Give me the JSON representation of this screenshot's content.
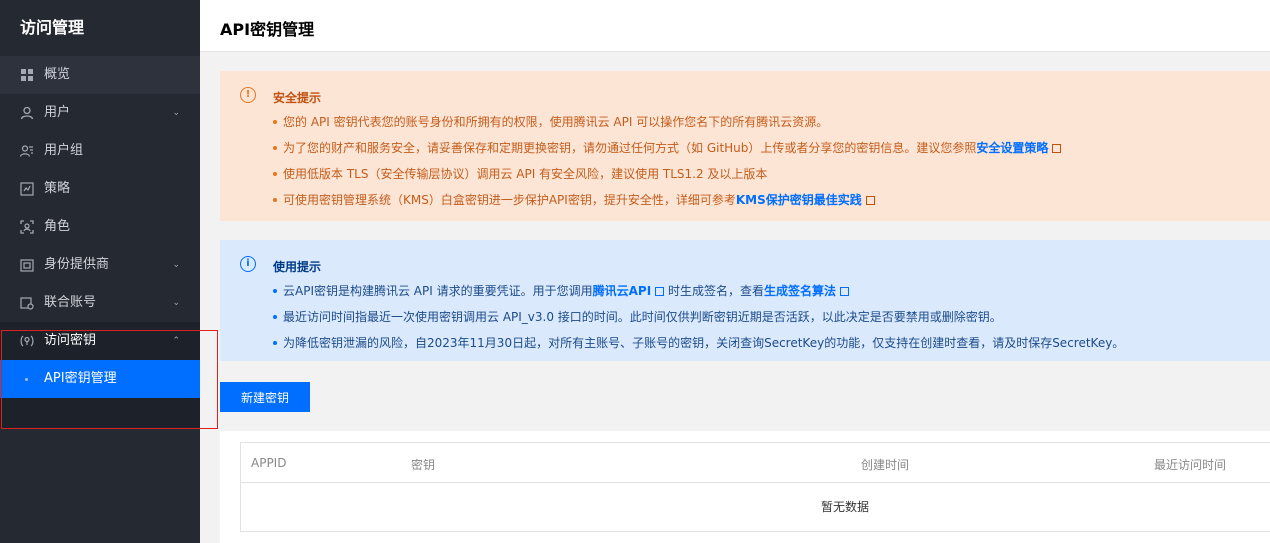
{
  "sidebar": {
    "title": "访问管理",
    "items": [
      {
        "label": "概览",
        "icon": "grid-icon"
      },
      {
        "label": "用户",
        "icon": "user-icon",
        "chevron": "⌄"
      },
      {
        "label": "用户组",
        "icon": "user-group-icon"
      },
      {
        "label": "策略",
        "icon": "policy-icon"
      },
      {
        "label": "角色",
        "icon": "role-icon"
      },
      {
        "label": "身份提供商",
        "icon": "identity-provider-icon",
        "chevron": "⌄"
      },
      {
        "label": "联合账号",
        "icon": "federated-account-icon",
        "chevron": "⌄"
      },
      {
        "label": "访问密钥",
        "icon": "key-icon",
        "chevron": "⌃"
      }
    ],
    "sub_item": {
      "label": "API密钥管理"
    }
  },
  "header": {
    "title": "API密钥管理"
  },
  "warning": {
    "title": "安全提示",
    "line1": "您的 API 密钥代表您的账号身份和所拥有的权限，使用腾讯云 API 可以操作您名下的所有腾讯云资源。",
    "line2_prefix": "为了您的财产和服务安全，请妥善保存和定期更换密钥，请勿通过任何方式（如 GitHub）上传或者分享您的密钥信息。建议您参照",
    "line2_link": "安全设置策略",
    "line3": "使用低版本 TLS（安全传输层协议）调用云 API 有安全风险，建议使用 TLS1.2 及以上版本",
    "line4_prefix": "可使用密钥管理系统（KMS）白盒密钥进一步保护API密钥，提升安全性，详细可参考",
    "line4_link": "KMS保护密钥最佳实践"
  },
  "info": {
    "title": "使用提示",
    "line1_prefix": "云API密钥是构建腾讯云 API 请求的重要凭证。用于您调用",
    "line1_link1": "腾讯云API",
    "line1_mid": " 时生成签名，查看",
    "line1_link2": "生成签名算法",
    "line2": "最近访问时间指最近一次使用密钥调用云 API_v3.0 接口的时间。此时间仅供判断密钥近期是否活跃，以此决定是否要禁用或删除密钥。",
    "line3": "为降低密钥泄漏的风险，自2023年11月30日起，对所有主账号、子账号的密钥，关闭查询SecretKey的功能，仅支持在创建时查看，请及时保存SecretKey。"
  },
  "new_button": "新建密钥",
  "table": {
    "columns": [
      "APPID",
      "密钥",
      "创建时间",
      "最近访问时间"
    ],
    "empty_text": "暂无数据"
  },
  "colors": {
    "primary": "#006eff",
    "sidebar_bg": "#252932",
    "warn_bg": "#fce5d5",
    "info_bg": "#dbe9fd",
    "highlight_box": "#e02020"
  }
}
